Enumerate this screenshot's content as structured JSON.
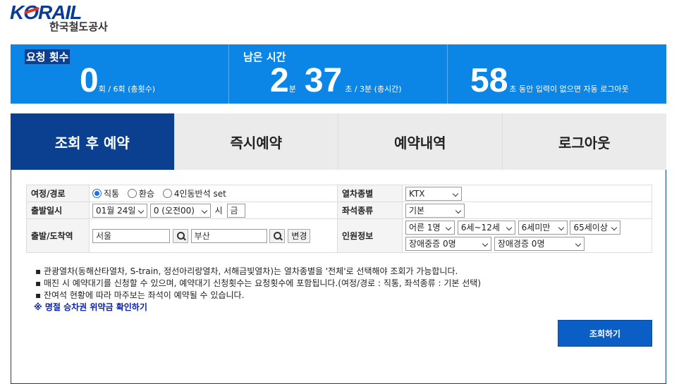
{
  "logo": {
    "main_k": "K",
    "main_rest": "RAIL",
    "main_o": "O",
    "sub": "한국철도공사"
  },
  "banner": {
    "request": {
      "title": "요청 횟수",
      "value": "0",
      "unit_text": "회 / 6회 (총횟수)"
    },
    "remaining": {
      "title": "남은 시간",
      "minutes": "2",
      "min_unit": "분",
      "seconds": "37",
      "sec_unit": "초 / 3분 (총시간)"
    },
    "idle": {
      "value": "58",
      "text": "초 동안 입력이 없으면 자동 로그아웃"
    }
  },
  "tabs": [
    {
      "label": "조회 후 예약",
      "active": true
    },
    {
      "label": "즉시예약",
      "active": false
    },
    {
      "label": "예약내역",
      "active": false
    },
    {
      "label": "로그아웃",
      "active": false
    }
  ],
  "form": {
    "route": {
      "label": "여정/경로",
      "options": [
        {
          "label": "직통",
          "selected": true
        },
        {
          "label": "환승",
          "selected": false
        },
        {
          "label": "4인동반석 set",
          "selected": false
        }
      ]
    },
    "train_type": {
      "label": "열차종별",
      "value": "KTX"
    },
    "departure_date": {
      "label": "출발일시",
      "date": "01월 24일",
      "hour": "0 (오전00)",
      "hour_suffix": "시",
      "weekday": "금"
    },
    "seat_type": {
      "label": "좌석종류",
      "value": "기본"
    },
    "stations": {
      "label": "출발/도착역",
      "departure": "서울",
      "arrival": "부산",
      "change_label": "변경"
    },
    "passengers": {
      "label": "인원정보",
      "adult": "어른 1명",
      "child": "6세~12세",
      "infant": "6세미만",
      "senior": "65세이상",
      "severe_disabled": "장애중증 0명",
      "mild_disabled": "장애경증 0명"
    }
  },
  "notes": [
    "▪ 관광열차(동해산타열차, S-train, 정선아리랑열차, 서해금빛열차)는 열차종별을 '전체'로 선택해야 조회가 가능합니다.",
    "▪ 매진 시 예약대기를 신청할 수 있으며, 예약대기 신청횟수는 요청횟수에 포함됩니다.(여정/경로 : 직통, 좌석종류 : 기본 선택)",
    "▪ 잔여석 현황에 따라 마주보는 좌석이 예약될 수 있습니다."
  ],
  "refund_link": "※ 명절 승차권 위약금 확인하기",
  "submit_label": "조회하기"
}
